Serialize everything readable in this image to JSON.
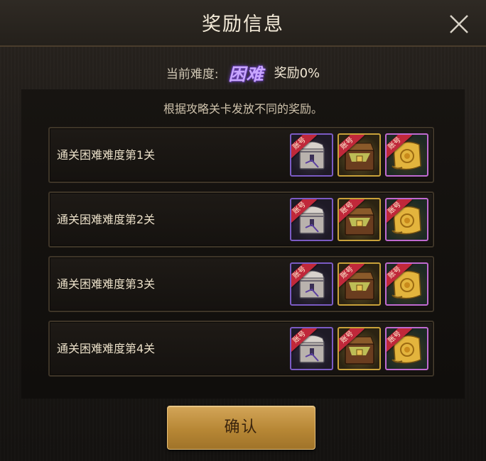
{
  "dialog": {
    "title": "奖励信息",
    "difficulty_label": "当前难度:",
    "difficulty_value": "困难",
    "difficulty_reward": "奖励0%",
    "subtitle": "根据攻略关卡发放不同的奖励。",
    "confirm_label": "确认"
  },
  "rewards": [
    {
      "label": "通关困难难度第1关",
      "items": [
        {
          "name": "silver-chest",
          "frame": "purple",
          "tag": "账号"
        },
        {
          "name": "gold-chest",
          "frame": "gold",
          "tag": "账号"
        },
        {
          "name": "gold-scroll",
          "frame": "pink",
          "tag": "账号"
        }
      ]
    },
    {
      "label": "通关困难难度第2关",
      "items": [
        {
          "name": "silver-chest",
          "frame": "purple",
          "tag": "账号"
        },
        {
          "name": "gold-chest",
          "frame": "gold",
          "tag": "账号"
        },
        {
          "name": "gold-scroll",
          "frame": "pink",
          "tag": "账号"
        }
      ]
    },
    {
      "label": "通关困难难度第3关",
      "items": [
        {
          "name": "silver-chest",
          "frame": "purple",
          "tag": "账号"
        },
        {
          "name": "gold-chest",
          "frame": "gold",
          "tag": "账号"
        },
        {
          "name": "gold-scroll",
          "frame": "pink",
          "tag": "账号"
        }
      ]
    },
    {
      "label": "通关困难难度第4关",
      "items": [
        {
          "name": "silver-chest",
          "frame": "purple",
          "tag": "账号"
        },
        {
          "name": "gold-chest",
          "frame": "gold",
          "tag": "账号"
        },
        {
          "name": "gold-scroll",
          "frame": "pink",
          "tag": "账号"
        }
      ]
    }
  ],
  "colors": {
    "accent_gold": "#b78735",
    "difficulty_purple": "#c9a6ff",
    "tag_red": "#c0283a"
  }
}
